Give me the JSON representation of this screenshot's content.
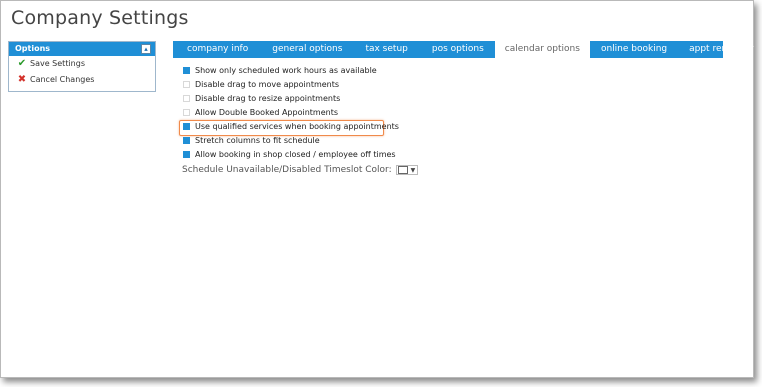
{
  "window": {
    "title": "Company Settings"
  },
  "options_panel": {
    "header": "Options",
    "collapse_glyph": "▴",
    "items": [
      {
        "label": "Save Settings",
        "icon": "check-icon"
      },
      {
        "label": "Cancel Changes",
        "icon": "x-icon"
      }
    ]
  },
  "tabs": [
    {
      "label": "company info",
      "active": false
    },
    {
      "label": "general options",
      "active": false
    },
    {
      "label": "tax setup",
      "active": false
    },
    {
      "label": "pos options",
      "active": false
    },
    {
      "label": "calendar options",
      "active": true
    },
    {
      "label": "online booking",
      "active": false
    },
    {
      "label": "appt reminder",
      "active": false
    }
  ],
  "calendar_options": [
    {
      "label": "Show only scheduled work hours as available",
      "checked": true
    },
    {
      "label": "Disable drag to move appointments",
      "checked": false
    },
    {
      "label": "Disable drag to resize appointments",
      "checked": false
    },
    {
      "label": "Allow Double Booked Appointments",
      "checked": false
    },
    {
      "label": "Use qualified services when booking appointments",
      "checked": true,
      "highlighted": true
    },
    {
      "label": "Stretch columns to fit schedule",
      "checked": true
    },
    {
      "label": "Allow booking in shop closed / employee off times",
      "checked": true
    }
  ],
  "timeslot_color": {
    "label": "Schedule Unavailable/Disabled Timeslot Color:",
    "value_color": "#ffffff",
    "caret": "▼"
  },
  "colors": {
    "accent": "#1f8fd6",
    "highlight": "#f08a4b"
  }
}
